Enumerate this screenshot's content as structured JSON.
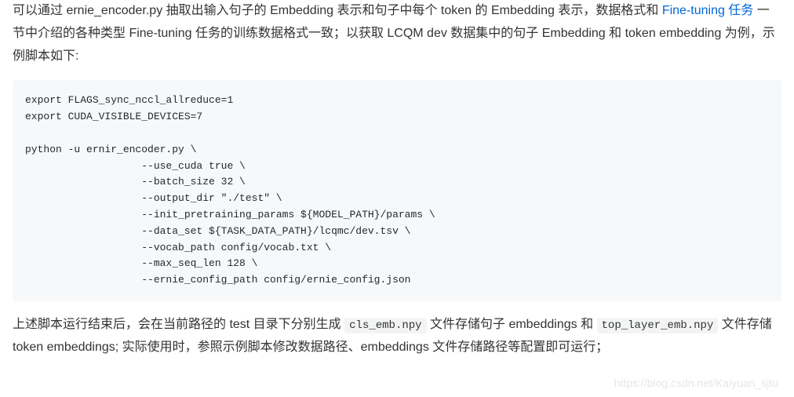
{
  "paragraph1": {
    "part1": "可以通过 ernie_encoder.py 抽取出输入句子的 Embedding 表示和句子中每个 token 的 Embedding 表示，数据格式和 ",
    "link": "Fine-tuning 任务",
    "part2": " 一节中介绍的各种类型 Fine-tuning 任务的训练数据格式一致；以获取 LCQM dev 数据集中的句子 Embedding 和 token embedding 为例，示例脚本如下:"
  },
  "code": "export FLAGS_sync_nccl_allreduce=1\nexport CUDA_VISIBLE_DEVICES=7\n\npython -u ernir_encoder.py \\\n                   --use_cuda true \\\n                   --batch_size 32 \\\n                   --output_dir \"./test\" \\\n                   --init_pretraining_params ${MODEL_PATH}/params \\\n                   --data_set ${TASK_DATA_PATH}/lcqmc/dev.tsv \\\n                   --vocab_path config/vocab.txt \\\n                   --max_seq_len 128 \\\n                   --ernie_config_path config/ernie_config.json",
  "paragraph2": {
    "part1": "上述脚本运行结束后，会在当前路径的 test 目录下分别生成 ",
    "code1": "cls_emb.npy",
    "part2": " 文件存储句子 embeddings 和 ",
    "code2": "top_layer_emb.npy",
    "part3": " 文件存储 token embeddings; 实际使用时，参照示例脚本修改数据路径、embeddings 文件存储路径等配置即可运行；"
  },
  "watermark": "https://blog.csdn.net/Kaiyuan_sjtu"
}
